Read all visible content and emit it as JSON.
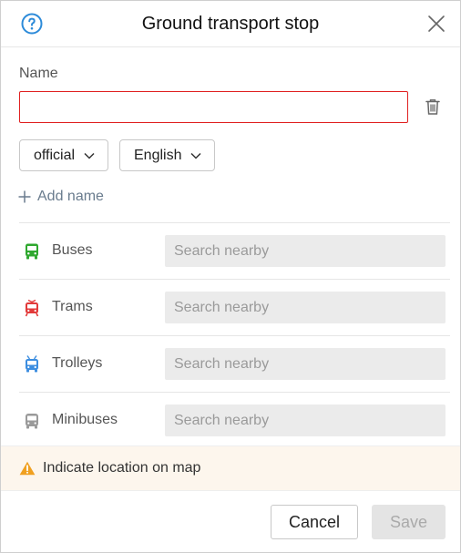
{
  "dialog": {
    "title": "Ground transport stop",
    "icons": {
      "help": "question-circle-icon",
      "close": "close-icon"
    }
  },
  "name_section": {
    "label": "Name",
    "input_value": "",
    "input_placeholder": "",
    "trash_icon": "trash-icon",
    "type_select": "official",
    "language_select": "English",
    "add_name_label": "Add name"
  },
  "transport": [
    {
      "id": "buses",
      "label": "Buses",
      "placeholder": "Search nearby",
      "icon": "bus-icon",
      "color": "#2fa82f"
    },
    {
      "id": "trams",
      "label": "Trams",
      "placeholder": "Search nearby",
      "icon": "tram-icon",
      "color": "#e23a3a"
    },
    {
      "id": "trolleys",
      "label": "Trolleys",
      "placeholder": "Search nearby",
      "icon": "trolleybus-icon",
      "color": "#3d8ee0"
    },
    {
      "id": "minibuses",
      "label": "Minibuses",
      "placeholder": "Search nearby",
      "icon": "minibus-icon",
      "color": "#9a9a9a"
    }
  ],
  "warning": {
    "text": "Indicate location on map",
    "icon": "warning-triangle-icon",
    "color": "#f0a020"
  },
  "buttons": {
    "cancel": "Cancel",
    "save": "Save"
  },
  "colors": {
    "error_border": "#e02020",
    "accent": "#2d8bd9",
    "warning_bg": "#fdf6ed"
  }
}
